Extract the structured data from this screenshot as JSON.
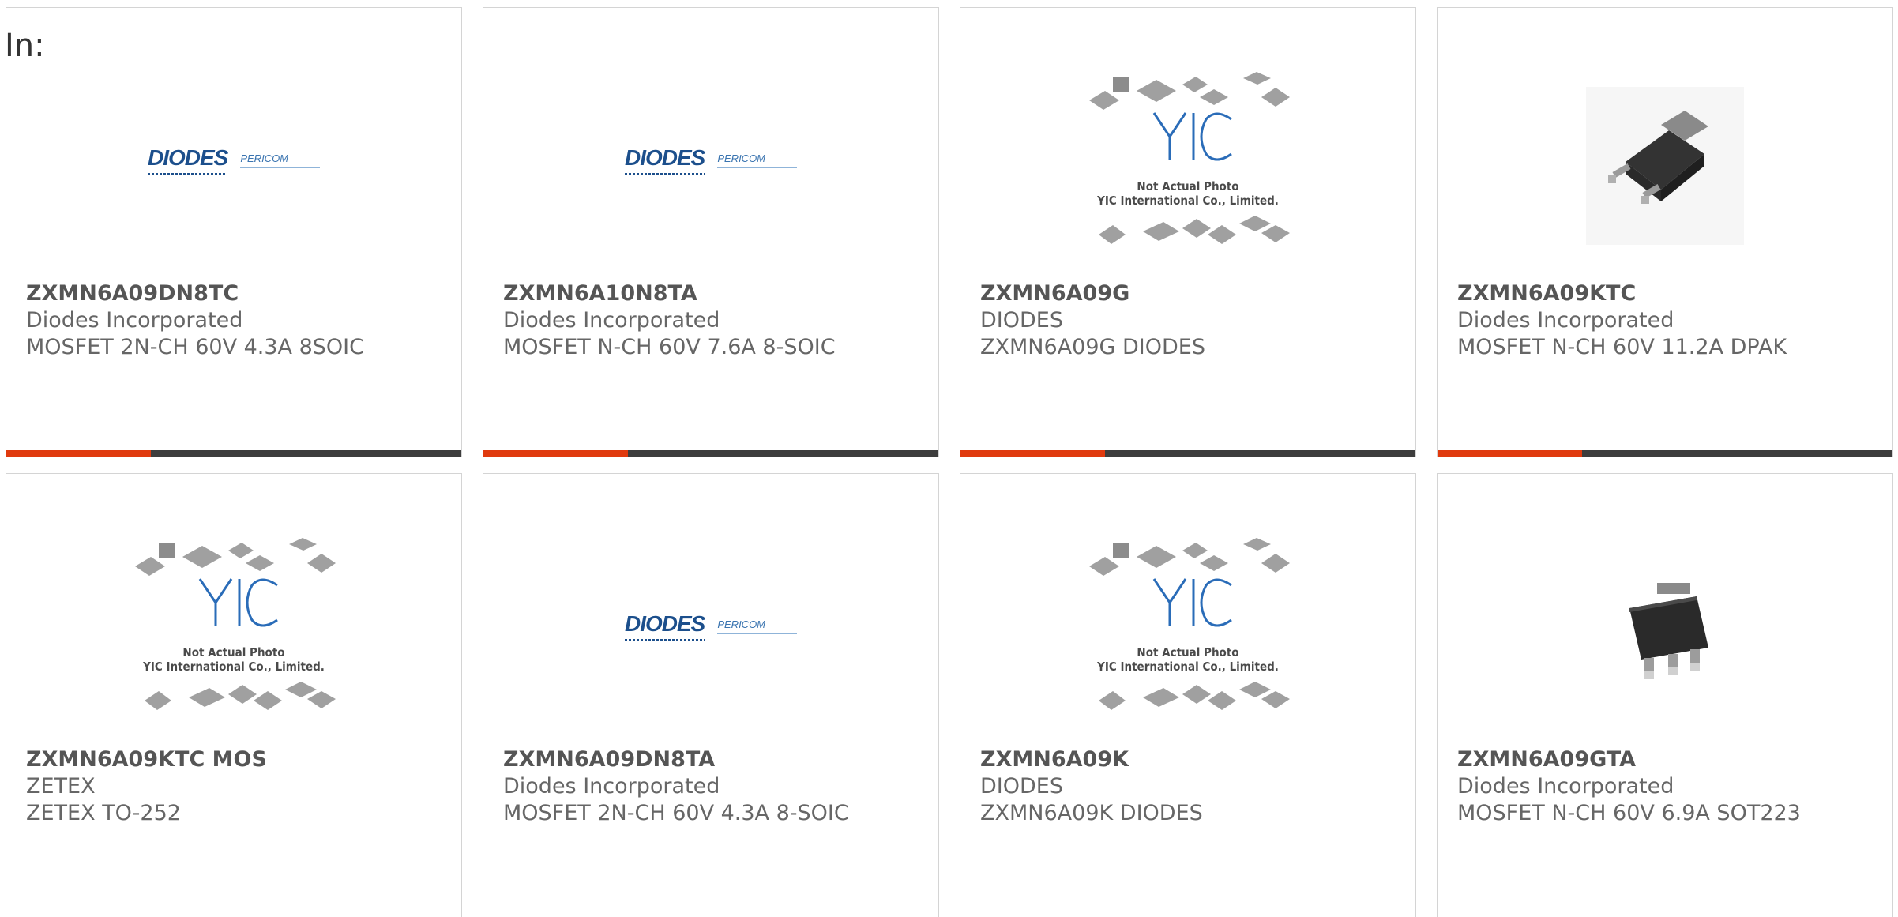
{
  "filter_label": "In:",
  "products": [
    {
      "part_number": "ZXMN6A09DN8TC",
      "manufacturer": "Diodes Incorporated",
      "description": "MOSFET 2N-CH 60V 4.3A 8SOIC",
      "image": "diodes-logo"
    },
    {
      "part_number": "ZXMN6A10N8TA",
      "manufacturer": "Diodes Incorporated",
      "description": "MOSFET N-CH 60V 7.6A 8-SOIC",
      "image": "diodes-logo"
    },
    {
      "part_number": "ZXMN6A09G",
      "manufacturer": "DIODES",
      "description": "ZXMN6A09G DIODES",
      "image": "not-actual-photo"
    },
    {
      "part_number": "ZXMN6A09KTC",
      "manufacturer": "Diodes Incorporated",
      "description": "MOSFET N-CH 60V 11.2A DPAK",
      "image": "dpak-package"
    },
    {
      "part_number": "ZXMN6A09KTC MOS",
      "manufacturer": "ZETEX",
      "description": "ZETEX TO-252",
      "image": "not-actual-photo"
    },
    {
      "part_number": "ZXMN6A09DN8TA",
      "manufacturer": "Diodes Incorporated",
      "description": "MOSFET 2N-CH 60V 4.3A 8-SOIC",
      "image": "diodes-logo"
    },
    {
      "part_number": "ZXMN6A09K",
      "manufacturer": "DIODES",
      "description": "ZXMN6A09K DIODES",
      "image": "not-actual-photo"
    },
    {
      "part_number": "ZXMN6A09GTA",
      "manufacturer": "Diodes Incorporated",
      "description": "MOSFET N-CH 60V 6.9A SOT223",
      "image": "sot223-package"
    }
  ],
  "logo_text": {
    "diodes": "DIODES",
    "pericom": "PERICOM",
    "yic_line1": "Not Actual Photo",
    "yic_line2": "YIC International Co., Limited.",
    "yic_mark": "YIC"
  },
  "colors": {
    "accent": "#e03a0e",
    "bar": "#3d3d3d",
    "logo_blue": "#1c4f8c"
  }
}
